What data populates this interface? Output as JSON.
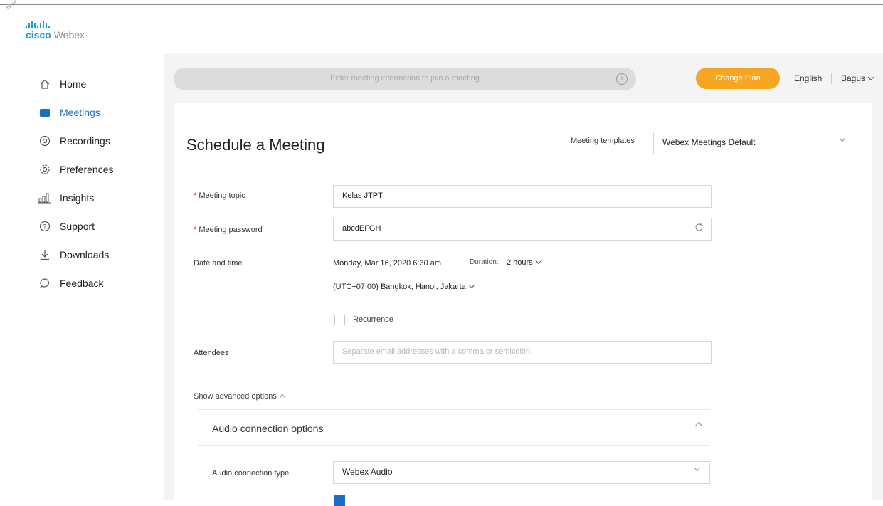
{
  "corner": "New",
  "logo": {
    "cisco": "cisco",
    "product": "Webex"
  },
  "sidebar": {
    "items": [
      {
        "label": "Home",
        "icon": "home-icon"
      },
      {
        "label": "Meetings",
        "icon": "calendar-icon"
      },
      {
        "label": "Recordings",
        "icon": "recordings-icon"
      },
      {
        "label": "Preferences",
        "icon": "gear-icon"
      },
      {
        "label": "Insights",
        "icon": "insights-icon"
      },
      {
        "label": "Support",
        "icon": "help-icon"
      },
      {
        "label": "Downloads",
        "icon": "download-icon"
      },
      {
        "label": "Feedback",
        "icon": "feedback-icon"
      }
    ],
    "active_index": 1
  },
  "topbar": {
    "search_placeholder": "Enter meeting information to join a meeting",
    "info_glyph": "i",
    "plan_button": "Change Plan",
    "language": "English",
    "user": "Bagus"
  },
  "form": {
    "title": "Schedule a Meeting",
    "templates_label": "Meeting templates",
    "templates_value": "Webex Meetings Default",
    "topic_label": "Meeting topic",
    "topic_value": "Kelas JTPT",
    "password_label": "Meeting password",
    "password_value": "abcdEFGH",
    "datetime_label": "Date and time",
    "datetime_value": "Monday, Mar 16, 2020 6:30 am",
    "duration_label": "Duration:",
    "duration_value": "2 hours",
    "timezone_value": "(UTC+07:00) Bangkok, Hanoi, Jakarta",
    "recurrence_label": "Recurrence",
    "attendees_label": "Attendees",
    "attendees_placeholder": "Separate email addresses with a comma or semicolon",
    "advanced_label": "Show advanced options",
    "audio_section_title": "Audio connection options",
    "audio_type_label": "Audio connection type",
    "audio_type_value": "Webex Audio"
  },
  "colors": {
    "accent": "#1b6fc2",
    "plan_button": "#f5a623",
    "required": "#d0021b"
  }
}
